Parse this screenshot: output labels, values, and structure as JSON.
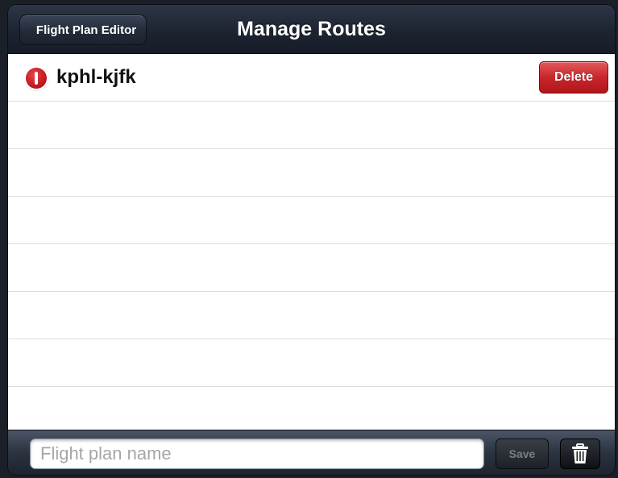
{
  "navbar": {
    "back_label": "Flight Plan Editor",
    "title": "Manage Routes"
  },
  "routes": [
    {
      "name": "kphl-kjfk",
      "delete_label": "Delete"
    }
  ],
  "toolbar": {
    "name_placeholder": "Flight plan name",
    "name_value": "",
    "save_label": "Save"
  },
  "icons": {
    "delete_indicator": "minus-circle-icon",
    "trash": "trash-icon"
  },
  "colors": {
    "navbar": "#1d2431",
    "delete_red": "#c8262b",
    "list_background": "#ffffff"
  }
}
